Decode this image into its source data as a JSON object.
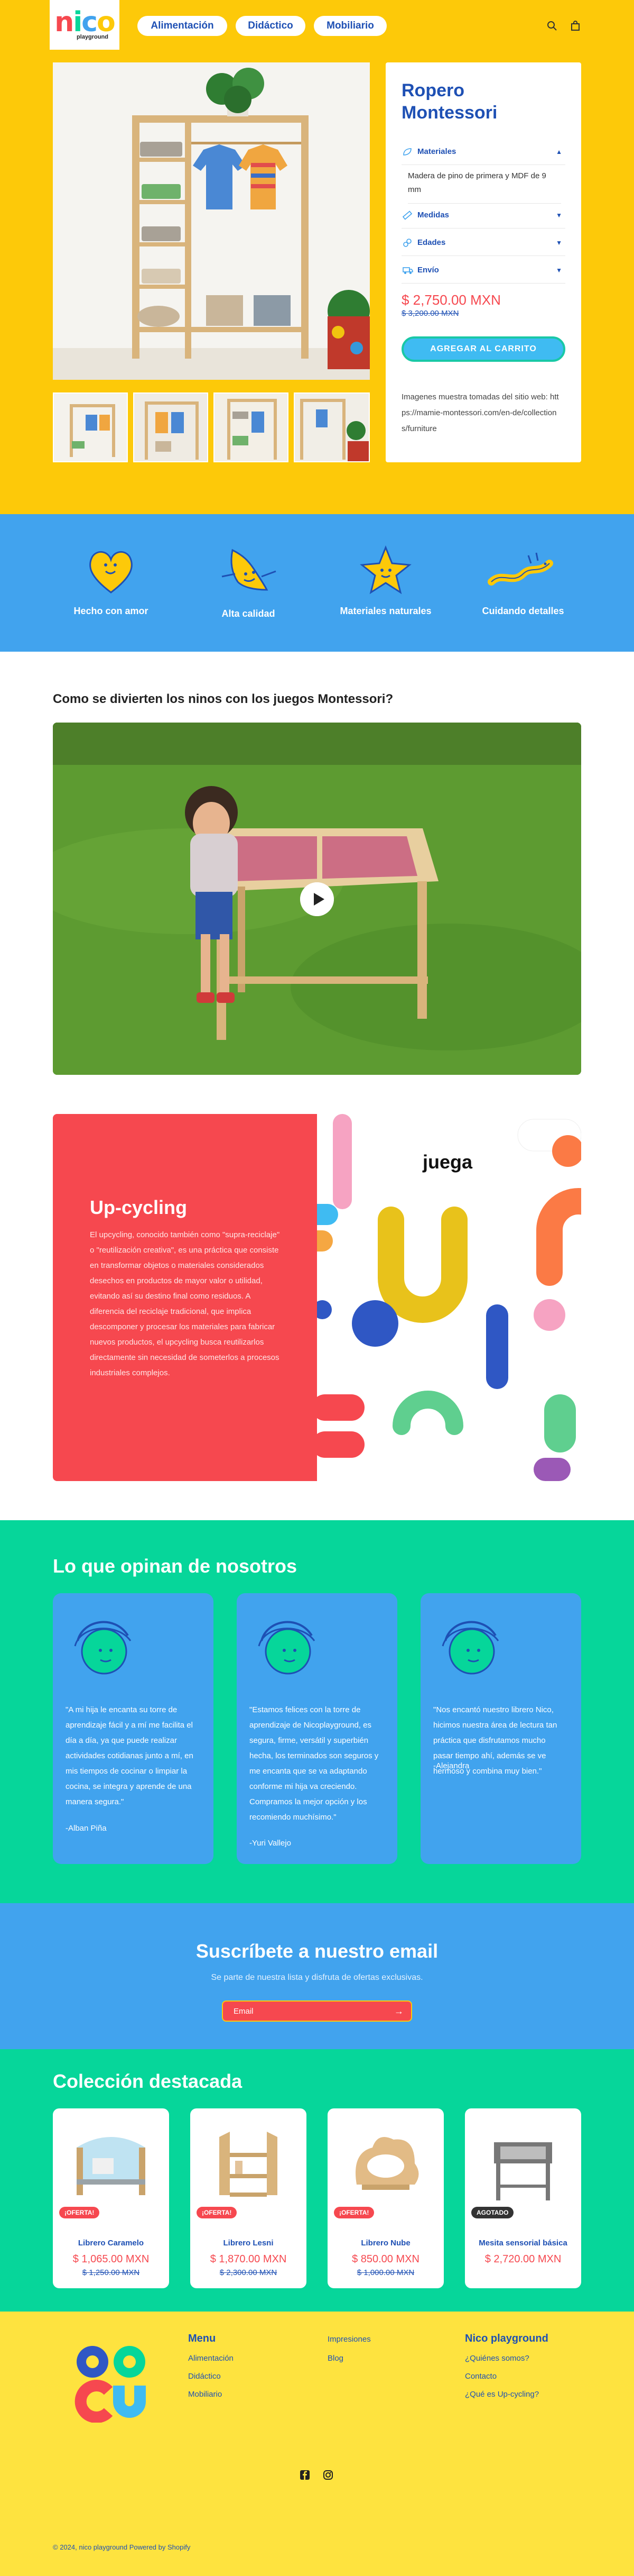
{
  "header": {
    "logo_text": "nico",
    "logo_sub": "playground",
    "nav": [
      "Alimentación",
      "Didáctico",
      "Mobiliario"
    ],
    "search_icon": "search-icon",
    "cart_icon": "bag-icon"
  },
  "product": {
    "title": "Ropero Montessori",
    "accordions": [
      {
        "label": "Materiales",
        "icon": "leaf-icon",
        "open": true,
        "content": "Madera de pino de primera y MDF de 9 mm"
      },
      {
        "label": "Medidas",
        "icon": "ruler-icon",
        "open": false
      },
      {
        "label": "Edades",
        "icon": "link-icon",
        "open": false
      },
      {
        "label": "Envío",
        "icon": "truck-icon",
        "open": false
      }
    ],
    "price": "$ 2,750.00 MXN",
    "compare_price": "$ 3,200.00 MXN",
    "add_to_cart": "AGREGAR AL CARRITO",
    "note": "Imagenes muestra tomadas del sitio web: https://mamie-montessori.com/en-de/collections/furniture"
  },
  "features": [
    {
      "label": "Hecho con amor",
      "icon": "heart-character-icon"
    },
    {
      "label": "Alta calidad",
      "icon": "wave-character-icon"
    },
    {
      "label": "Materiales naturales",
      "icon": "star-character-icon"
    },
    {
      "label": "Cuidando detalles",
      "icon": "snake-character-icon"
    }
  ],
  "video": {
    "title": "Como se divierten los ninos con los juegos Montessori?",
    "play_icon": "play-icon"
  },
  "upcycling": {
    "title": "Up-cycling",
    "text": "El upcycling, conocido también como \"supra-reciclaje\" o \"reutilización creativa\", es una práctica que consiste en transformar objetos o materiales considerados desechos en productos de mayor valor o utilidad, evitando así su destino final como residuos. A diferencia del reciclaje tradicional, que implica descomponer y procesar los materiales para fabricar nuevos productos, el upcycling busca reutilizarlos directamente sin necesidad de someterlos a procesos industriales complejos.",
    "image_word": "juega"
  },
  "testimonials": {
    "title": "Lo que opinan de nosotros",
    "items": [
      {
        "text": "\"A mi hija le encanta su torre de aprendizaje fácil y a mí me facilita el día a día, ya que puede realizar actividades cotidianas junto a mí, en mis tiempos de cocinar o limpiar la cocina, se integra y aprende de una manera segura.\"",
        "author": "-Alban Piña"
      },
      {
        "text": "\"Estamos felices con la torre de aprendizaje de Nicoplayground, es segura, firme, versátil y superbién hecha, los terminados son seguros y me encanta que se va adaptando conforme mi hija va creciendo. Compramos la mejor opción y los recomiendo muchísimo.\"",
        "author": "-Yuri Vallejo"
      },
      {
        "text": "\"Nos encantó nuestro librero Nico, hicimos nuestra área de lectura tan práctica que disfrutamos mucho pasar tiempo ahí, además se ve hermoso y combina muy bien.\"",
        "author": "-Alejandra"
      }
    ]
  },
  "newsletter": {
    "title": "Suscríbete a nuestro email",
    "subtitle": "Se parte de nuestra lista y disfruta de ofertas exclusivas.",
    "placeholder": "Email"
  },
  "collection": {
    "title": "Colección destacada",
    "products": [
      {
        "name": "Librero Caramelo",
        "price": "$ 1,065.00 MXN",
        "old": "$ 1,250.00 MXN",
        "badge": "¡OFERTA!",
        "badge_color": "#f6484f"
      },
      {
        "name": "Librero Lesni",
        "price": "$ 1,870.00 MXN",
        "old": "$ 2,300.00 MXN",
        "badge": "¡OFERTA!",
        "badge_color": "#f6484f"
      },
      {
        "name": "Librero Nube",
        "price": "$ 850.00 MXN",
        "old": "$ 1,000.00 MXN",
        "badge": "¡OFERTA!",
        "badge_color": "#f6484f"
      },
      {
        "name": "Mesita sensorial básica",
        "price": "$ 2,720.00 MXN",
        "old": "",
        "badge": "AGOTADO",
        "badge_color": "#333333"
      }
    ]
  },
  "footer": {
    "menu_title": "Menu",
    "menu": [
      "Alimentación",
      "Didáctico",
      "Mobiliario"
    ],
    "col2": [
      "Impresiones",
      "Blog"
    ],
    "col3_title": "Nico playground",
    "col3": [
      "¿Quiénes somos?",
      "Contacto",
      "¿Qué es Up-cycling?"
    ],
    "social": [
      "facebook-icon",
      "instagram-icon"
    ],
    "copyright": "© 2024, nico playground Powered by Shopify"
  },
  "colors": {
    "yellow": "#fdc909",
    "blue": "#41a3ee",
    "green": "#06d69a",
    "red": "#f6484f",
    "navy": "#1e50b4"
  }
}
